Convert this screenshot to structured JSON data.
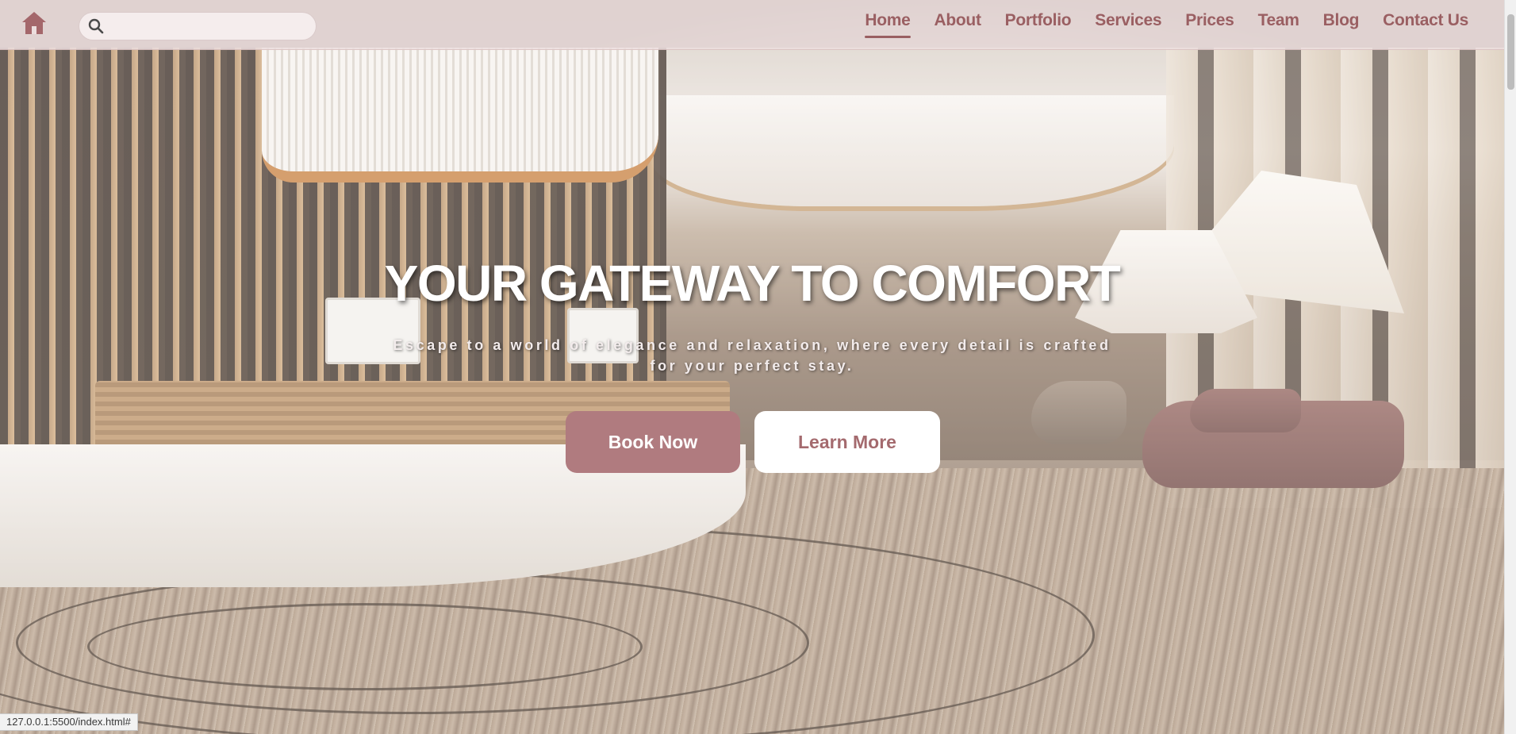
{
  "header": {
    "search": {
      "value": "",
      "placeholder": ""
    },
    "nav": {
      "home": "Home",
      "about": "About",
      "portfolio": "Portfolio",
      "services": "Services",
      "prices": "Prices",
      "team": "Team",
      "blog": "Blog",
      "contact": "Contact Us"
    },
    "active_item": "Home"
  },
  "hero": {
    "title": "YOUR GATEWAY TO COMFORT",
    "subtitle": "Escape to a world of elegance and relaxation, where every detail is crafted for your perfect stay.",
    "primary_button": "Book Now",
    "secondary_button": "Learn More"
  },
  "status_bar": {
    "url": "127.0.0.1:5500/index.html#"
  },
  "icons": {
    "home": "home-icon",
    "search": "search-icon"
  },
  "colors": {
    "accent": "#9a5f62",
    "primary_button_bg": "#b07b7f",
    "header_bg": "#ecdede"
  }
}
